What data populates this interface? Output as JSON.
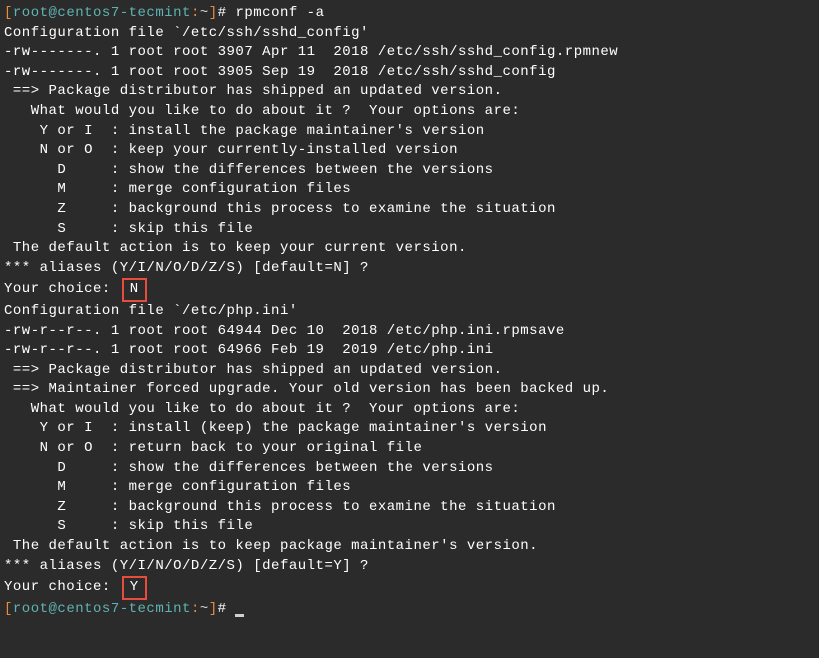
{
  "prompt1": {
    "open": "[",
    "user": "root@centos7-tecmint",
    "colon": ":",
    "path": "~",
    "close": "]",
    "hash": "# ",
    "cmd": "rpmconf -a"
  },
  "block1": {
    "l1": "Configuration file `/etc/ssh/sshd_config'",
    "l2": "-rw-------. 1 root root 3907 Apr 11  2018 /etc/ssh/sshd_config.rpmnew",
    "l3": "-rw-------. 1 root root 3905 Sep 19  2018 /etc/ssh/sshd_config",
    "l4": " ==> Package distributor has shipped an updated version.",
    "l5": "   What would you like to do about it ?  Your options are:",
    "l6": "    Y or I  : install the package maintainer's version",
    "l7": "    N or O  : keep your currently-installed version",
    "l8": "      D     : show the differences between the versions",
    "l9": "      M     : merge configuration files",
    "l10": "      Z     : background this process to examine the situation",
    "l11": "      S     : skip this file",
    "l12": " The default action is to keep your current version.",
    "l13": "*** aliases (Y/I/N/O/D/Z/S) [default=N] ?",
    "l14_label": "Your choice:",
    "l14_input": "N"
  },
  "block2": {
    "l1": "Configuration file `/etc/php.ini'",
    "l2": "-rw-r--r--. 1 root root 64944 Dec 10  2018 /etc/php.ini.rpmsave",
    "l3": "-rw-r--r--. 1 root root 64966 Feb 19  2019 /etc/php.ini",
    "l4": " ==> Package distributor has shipped an updated version.",
    "l5": " ==> Maintainer forced upgrade. Your old version has been backed up.",
    "l6": "   What would you like to do about it ?  Your options are:",
    "l7": "    Y or I  : install (keep) the package maintainer's version",
    "l8": "    N or O  : return back to your original file",
    "l9": "      D     : show the differences between the versions",
    "l10": "      M     : merge configuration files",
    "l11": "      Z     : background this process to examine the situation",
    "l12": "      S     : skip this file",
    "l13": " The default action is to keep package maintainer's version.",
    "l14": "*** aliases (Y/I/N/O/D/Z/S) [default=Y] ?",
    "l15_label": "Your choice:",
    "l15_input": "Y"
  },
  "prompt2": {
    "open": "[",
    "user": "root@centos7-tecmint",
    "colon": ":",
    "path": "~",
    "close": "]",
    "hash": "# "
  }
}
